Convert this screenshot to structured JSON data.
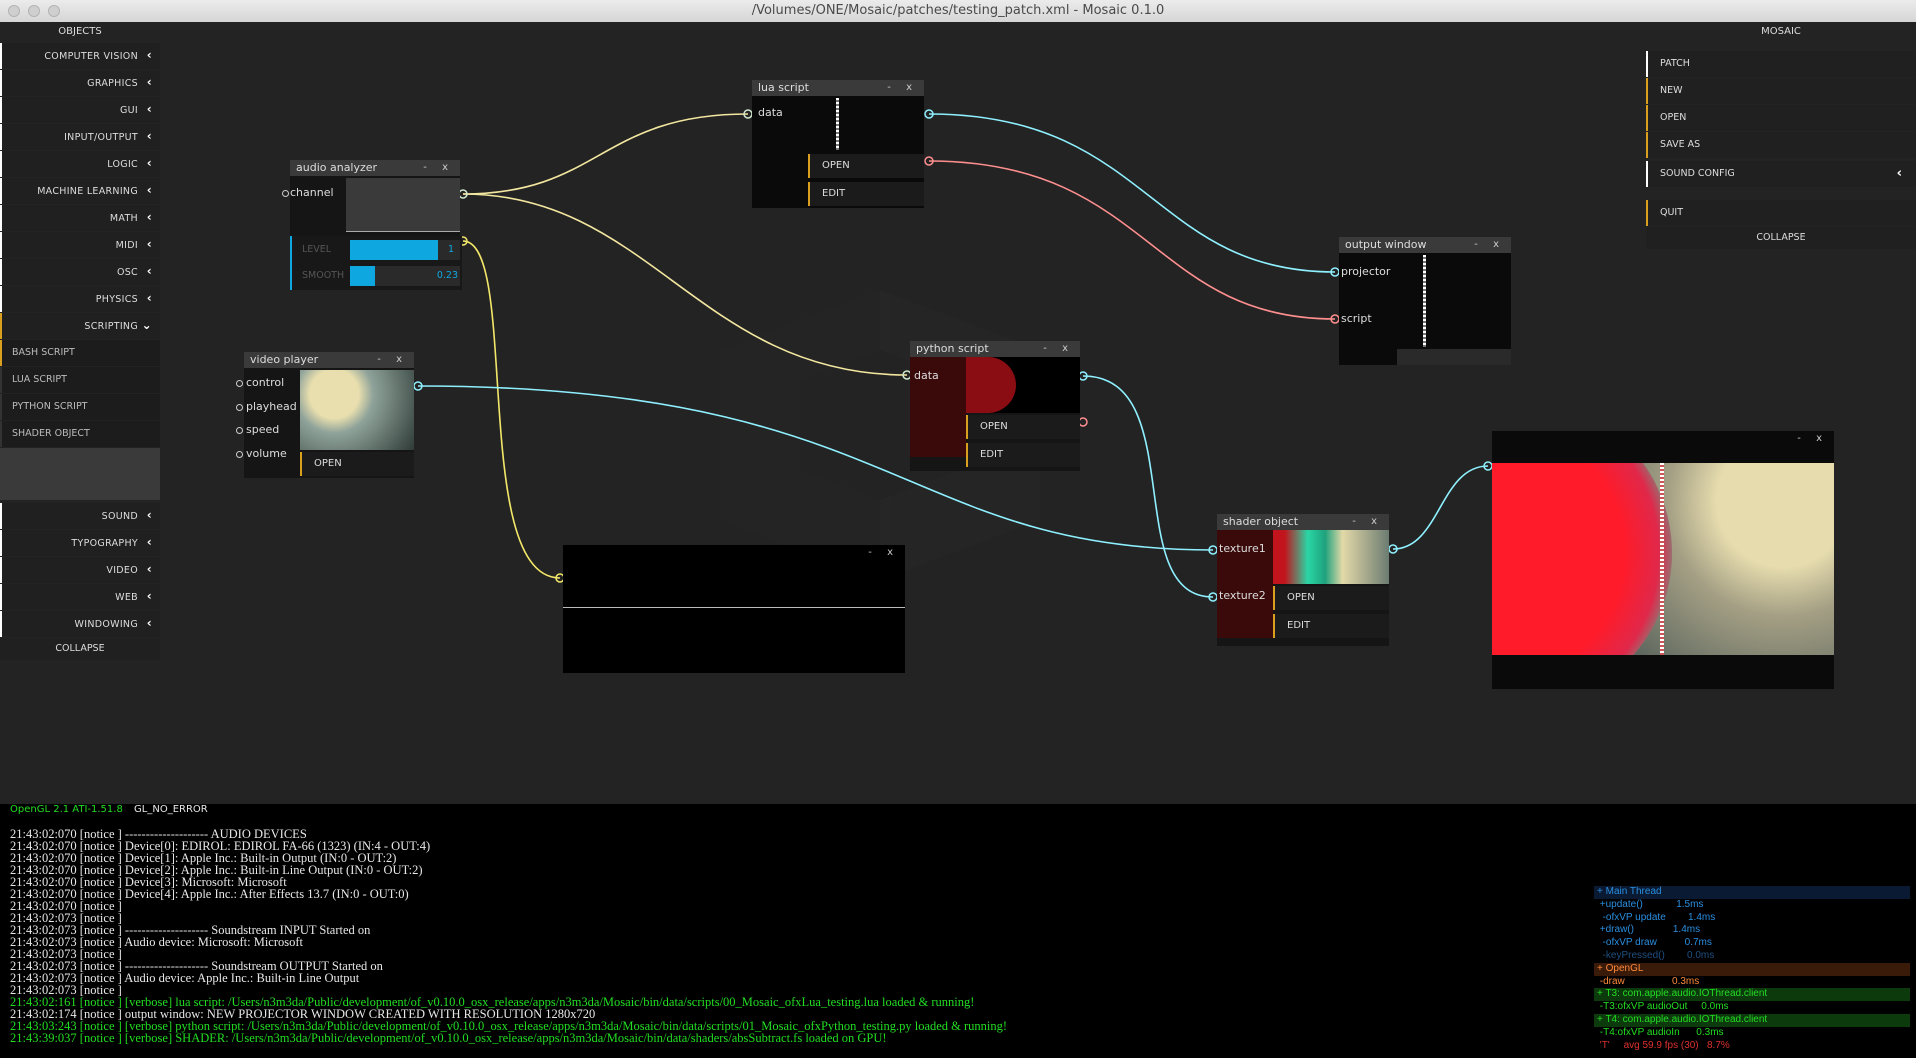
{
  "window": {
    "title": "/Volumes/ONE/Mosaic/patches/testing_patch.xml - Mosaic 0.1.0"
  },
  "objects_panel": {
    "title": "OBJECTS",
    "categories_top": [
      {
        "label": "COMPUTER VISION",
        "chevron": "‹"
      },
      {
        "label": "GRAPHICS",
        "chevron": "‹"
      },
      {
        "label": "GUI",
        "chevron": "‹"
      },
      {
        "label": "INPUT/OUTPUT",
        "chevron": "‹"
      },
      {
        "label": "LOGIC",
        "chevron": "‹"
      },
      {
        "label": "MACHINE LEARNING",
        "chevron": "‹"
      },
      {
        "label": "MATH",
        "chevron": "‹"
      },
      {
        "label": "MIDI",
        "chevron": "‹"
      },
      {
        "label": "OSC",
        "chevron": "‹"
      },
      {
        "label": "PHYSICS",
        "chevron": "‹"
      }
    ],
    "scripting": {
      "label": "SCRIPTING",
      "chevron": "⌄"
    },
    "scripting_items": [
      "BASH SCRIPT",
      "LUA SCRIPT",
      "PYTHON SCRIPT",
      "SHADER OBJECT"
    ],
    "categories_bottom": [
      {
        "label": "SOUND",
        "chevron": "‹"
      },
      {
        "label": "TYPOGRAPHY",
        "chevron": "‹"
      },
      {
        "label": "VIDEO",
        "chevron": "‹"
      },
      {
        "label": "WEB",
        "chevron": "‹"
      },
      {
        "label": "WINDOWING",
        "chevron": "‹"
      }
    ],
    "collapse": "COLLAPSE"
  },
  "mosaic_panel": {
    "title": "MOSAIC",
    "patch": "PATCH",
    "new": "NEW",
    "open": "OPEN",
    "save_as": "SAVE AS",
    "sound_config": "SOUND CONFIG",
    "sound_config_chevron": "‹",
    "quit": "QUIT",
    "collapse": "COLLAPSE"
  },
  "nodes": {
    "audio_analyzer": {
      "title": "audio analyzer",
      "port": "channel",
      "level_label": "LEVEL",
      "level_value": "1",
      "level_fraction": 0.8,
      "smooth_label": "SMOOTH",
      "smooth_value": "0.23",
      "smooth_fraction": 0.23
    },
    "lua_script": {
      "title": "lua script",
      "port": "data",
      "open": "OPEN",
      "edit": "EDIT"
    },
    "video_player": {
      "title": "video player",
      "ports": [
        "control",
        "playhead",
        "speed",
        "volume"
      ],
      "open": "OPEN"
    },
    "python_script": {
      "title": "python script",
      "port": "data",
      "open": "OPEN",
      "edit": "EDIT"
    },
    "output_window": {
      "title": "output window",
      "ports": [
        "projector",
        "script"
      ]
    },
    "shader_object": {
      "title": "shader object",
      "ports": [
        "texture1",
        "texture2"
      ],
      "open": "OPEN",
      "edit": "EDIT"
    },
    "header_controls": "- x",
    "close_glyph": "x"
  },
  "console": {
    "gl_info": "OpenGL 2.1 ATI-1.51.8",
    "gl_error": "GL_NO_ERROR",
    "logs": [
      {
        "text": "21:43:02:070 [notice ] -------------------- AUDIO DEVICES",
        "color": "#e8e8e8"
      },
      {
        "text": "21:43:02:070 [notice ] Device[0]: EDIROL: EDIROL FA-66 (1323) (IN:4 - OUT:4)",
        "color": "#e8e8e8"
      },
      {
        "text": "21:43:02:070 [notice ] Device[1]: Apple Inc.: Built-in Output (IN:0 - OUT:2)",
        "color": "#e8e8e8"
      },
      {
        "text": "21:43:02:070 [notice ] Device[2]: Apple Inc.: Built-in Line Output (IN:0 - OUT:2)",
        "color": "#e8e8e8"
      },
      {
        "text": "21:43:02:070 [notice ] Device[3]: Microsoft: Microsoft",
        "color": "#e8e8e8"
      },
      {
        "text": "21:43:02:070 [notice ] Device[4]: Apple Inc.: After Effects 13.7 (IN:0 - OUT:0)",
        "color": "#e8e8e8"
      },
      {
        "text": "21:43:02:070 [notice ]",
        "color": "#e8e8e8"
      },
      {
        "text": "21:43:02:073 [notice ]",
        "color": "#e8e8e8"
      },
      {
        "text": "21:43:02:073 [notice ] -------------------- Soundstream INPUT Started on",
        "color": "#e8e8e8"
      },
      {
        "text": "21:43:02:073 [notice ] Audio device: Microsoft: Microsoft",
        "color": "#e8e8e8"
      },
      {
        "text": "21:43:02:073 [notice ]",
        "color": "#e8e8e8"
      },
      {
        "text": "21:43:02:073 [notice ] -------------------- Soundstream OUTPUT Started on",
        "color": "#e8e8e8"
      },
      {
        "text": "21:43:02:073 [notice ] Audio device: Apple Inc.: Built-in Line Output",
        "color": "#e8e8e8"
      },
      {
        "text": "21:43:02:073 [notice ]",
        "color": "#e8e8e8"
      },
      {
        "text": "21:43:02:161 [notice ] [verbose] lua script: /Users/n3m3da/Public/development/of_v0.10.0_osx_release/apps/n3m3da/Mosaic/bin/data/scripts/00_Mosaic_ofxLua_testing.lua loaded & running!",
        "color": "#22dd22"
      },
      {
        "text": "21:43:02:174 [notice ] output window: NEW PROJECTOR WINDOW CREATED WITH RESOLUTION 1280x720",
        "color": "#e8e8e8"
      },
      {
        "text": "21:43:03:243 [notice ] [verbose] python script: /Users/n3m3da/Public/development/of_v0.10.0_osx_release/apps/n3m3da/Mosaic/bin/data/scripts/01_Mosaic_ofxPython_testing.py loaded & running!",
        "color": "#22dd22"
      },
      {
        "text": "21:43:39:037 [notice ] [verbose] SHADER: /Users/n3m3da/Public/development/of_v0.10.0_osx_release/apps/n3m3da/Mosaic/bin/data/shaders/absSubtract.fs loaded on GPU!",
        "color": "#22dd22"
      }
    ]
  },
  "profiler": [
    {
      "text": "+ Main Thread",
      "color": "#2a8ee0",
      "bg": "#0a1a33"
    },
    {
      "text": " +update()            1.5ms",
      "color": "#2a8ee0",
      "bg": "#000000"
    },
    {
      "text": "  -ofxVP update        1.4ms",
      "color": "#2a8ee0",
      "bg": "#000000"
    },
    {
      "text": " +draw()              1.4ms",
      "color": "#2a8ee0",
      "bg": "#000000"
    },
    {
      "text": "  -ofxVP draw          0.7ms",
      "color": "#2a8ee0",
      "bg": "#000000"
    },
    {
      "text": "  -keyPressed()        0.0ms",
      "color": "#1f4f80",
      "bg": "#000000"
    },
    {
      "text": "+ OpenGL",
      "color": "#ff8a3a",
      "bg": "#3a1a08"
    },
    {
      "text": " -draw                 0.3ms",
      "color": "#ff8a3a",
      "bg": "#000000"
    },
    {
      "text": "+ T3: com.apple.audio.IOThread.client",
      "color": "#22dd22",
      "bg": "#0d3a0d"
    },
    {
      "text": " -T3:ofxVP audioOut     0.0ms",
      "color": "#22dd22",
      "bg": "#000000"
    },
    {
      "text": "+ T4: com.apple.audio.IOThread.client",
      "color": "#22dd22",
      "bg": "#0d3a0d"
    },
    {
      "text": " -T4:ofxVP audioIn      0.3ms",
      "color": "#22dd22",
      "bg": "#000000"
    },
    {
      "text": " 'T'     avg 59.9 fps (30)   8.7%",
      "color": "#e03030",
      "bg": "#000000"
    }
  ]
}
